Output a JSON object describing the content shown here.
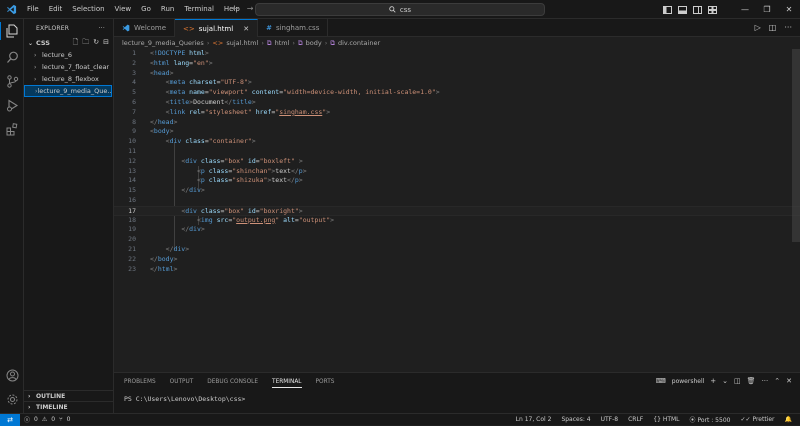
{
  "menu": [
    "File",
    "Edit",
    "Selection",
    "View",
    "Go",
    "Run",
    "Terminal",
    "Help"
  ],
  "search": {
    "text": "css"
  },
  "explorer": {
    "title": "EXPLORER",
    "folder": "CSS",
    "items": [
      {
        "label": "lecture_6"
      },
      {
        "label": "lecture_7_float_clear"
      },
      {
        "label": "lecture_8_flexbox"
      },
      {
        "label": "lecture_9_media_Que..."
      }
    ],
    "outline": "OUTLINE",
    "timeline": "TIMELINE"
  },
  "tabs": [
    {
      "label": "Welcome"
    },
    {
      "label": "sujal.html"
    },
    {
      "label": "singham.css"
    }
  ],
  "breadcrumb": [
    "lecture_9_media_Queries",
    "sujal.html",
    "html",
    "body",
    "div.container"
  ],
  "editor": {
    "current_line": "17",
    "lines": [
      {
        "n": "1"
      },
      {
        "n": "2"
      },
      {
        "n": "3"
      },
      {
        "n": "4"
      },
      {
        "n": "5"
      },
      {
        "n": "6"
      },
      {
        "n": "7"
      },
      {
        "n": "8"
      },
      {
        "n": "9"
      },
      {
        "n": "10"
      },
      {
        "n": "11"
      },
      {
        "n": "12"
      },
      {
        "n": "13"
      },
      {
        "n": "14"
      },
      {
        "n": "15"
      },
      {
        "n": "16"
      },
      {
        "n": "17"
      },
      {
        "n": "18"
      },
      {
        "n": "19"
      },
      {
        "n": "20"
      },
      {
        "n": "21"
      },
      {
        "n": "22"
      },
      {
        "n": "23"
      }
    ]
  },
  "panel": {
    "tabs": [
      "PROBLEMS",
      "OUTPUT",
      "DEBUG CONSOLE",
      "TERMINAL",
      "PORTS"
    ],
    "active_tab": "TERMINAL",
    "shell": "powershell",
    "prompt": "PS C:\\Users\\Lenovo\\Desktop\\css>"
  },
  "status": {
    "errors": "0",
    "warnings": "0",
    "ports": "0",
    "position": "Ln 17, Col 2",
    "spaces": "Spaces: 4",
    "encoding": "UTF-8",
    "eol": "CRLF",
    "language": "HTML",
    "port": "Port : 5500",
    "prettier": "Prettier"
  },
  "colors": {
    "accent": "#0078d4",
    "tag": "#569cd6",
    "attr": "#9cdcfe",
    "string": "#ce9178"
  }
}
